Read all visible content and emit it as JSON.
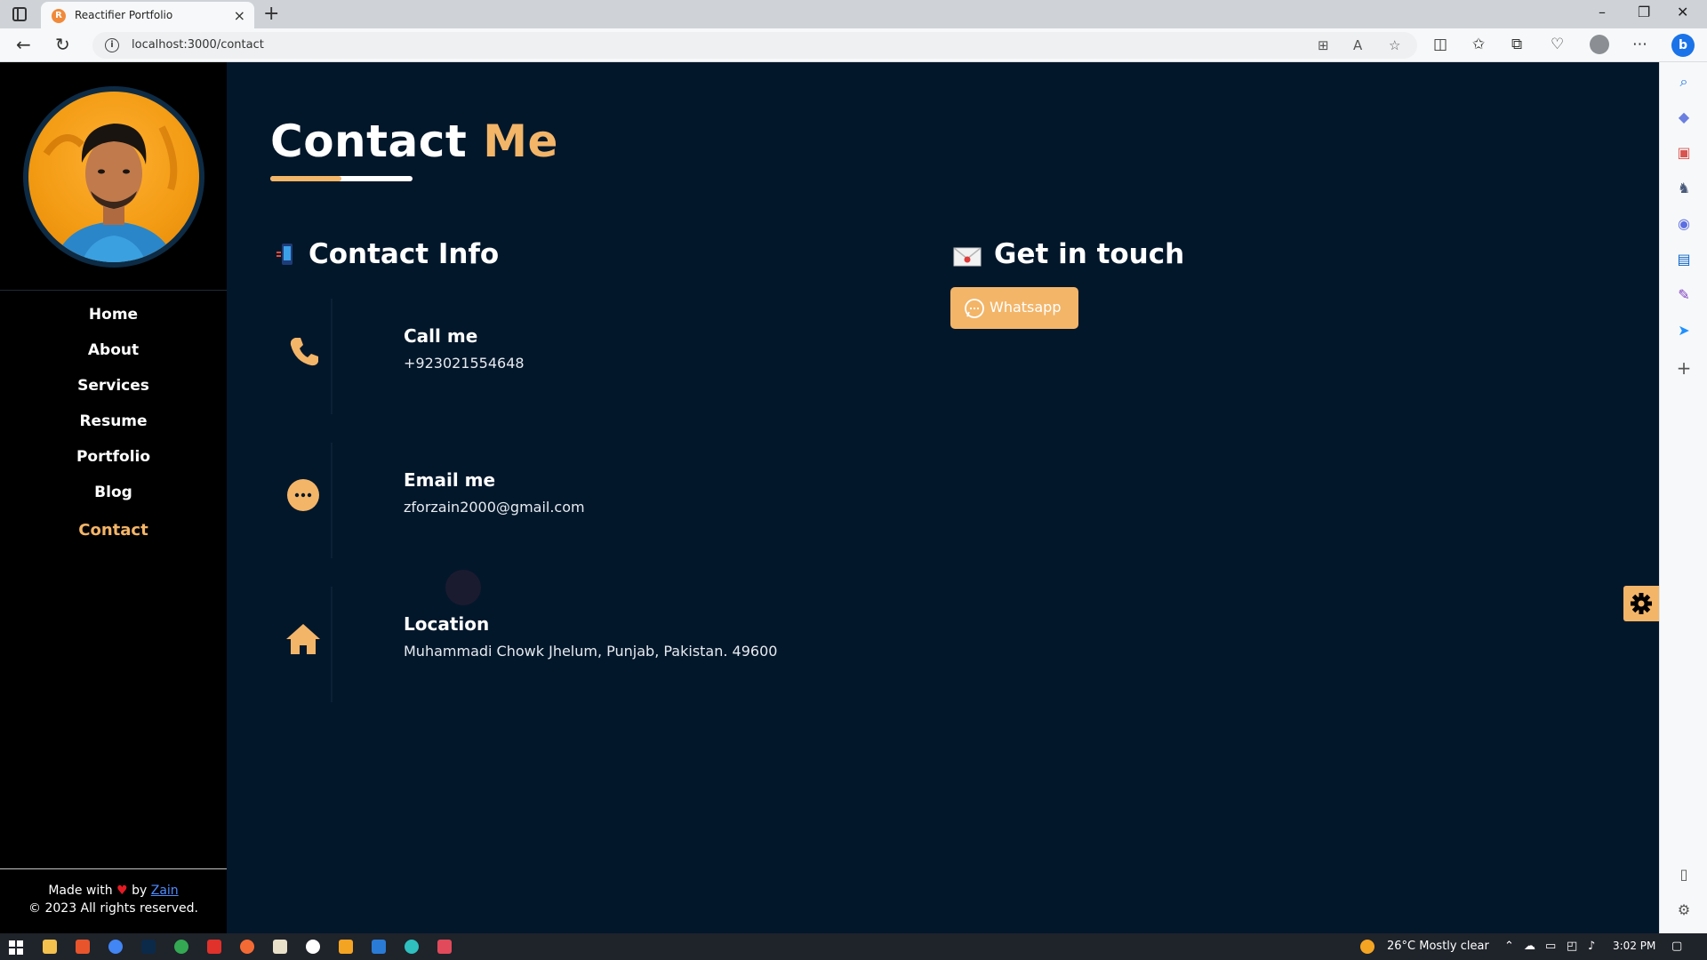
{
  "browser": {
    "tab_title": "Reactifier Portfolio",
    "favicon_letter": "R",
    "url": "localhost:3000/contact",
    "new_tab": "+",
    "close": "×",
    "minimize": "–",
    "restore": "❐",
    "window_close": "✕"
  },
  "sidebar": {
    "items": [
      {
        "label": "Home",
        "active": false
      },
      {
        "label": "About",
        "active": false
      },
      {
        "label": "Services",
        "active": false
      },
      {
        "label": "Resume",
        "active": false
      },
      {
        "label": "Portfolio",
        "active": false
      },
      {
        "label": "Blog",
        "active": false
      },
      {
        "label": "Contact",
        "active": true
      }
    ],
    "footer_made_with": "Made with",
    "footer_by": "by",
    "footer_author": "Zain",
    "footer_copyright": "© 2023 All rights reserved."
  },
  "page": {
    "title_main": "Contact",
    "title_accent": "Me",
    "contact_info_heading": "Contact Info",
    "get_in_touch_heading": "Get in touch",
    "whatsapp_label": "Whatsapp",
    "cards": [
      {
        "label": "Call me",
        "value": "+923021554648",
        "icon": "phone-icon"
      },
      {
        "label": "Email me",
        "value": "zforzain2000@gmail.com",
        "icon": "chat-icon"
      },
      {
        "label": "Location",
        "value": "Muhammadi Chowk Jhelum, Punjab, Pakistan. 49600",
        "icon": "home-icon"
      }
    ]
  },
  "taskbar": {
    "weather": "26°C  Mostly clear",
    "time": "3:02 PM"
  },
  "colors": {
    "accent": "#f3b568",
    "page_bg": "#03172b",
    "nav_bg": "#000000",
    "heart": "#e21b23"
  }
}
